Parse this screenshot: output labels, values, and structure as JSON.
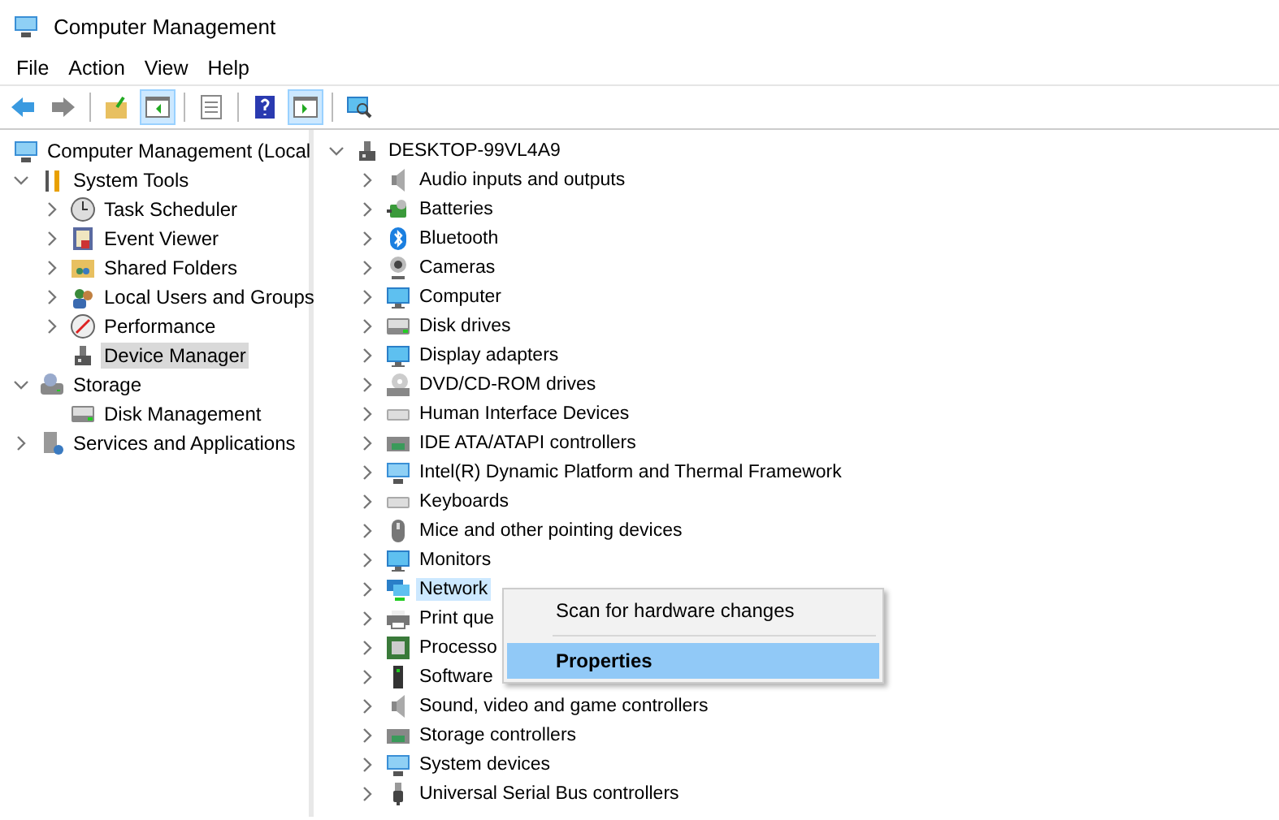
{
  "window": {
    "title": "Computer Management"
  },
  "menu_bar": [
    {
      "label": "File"
    },
    {
      "label": "Action"
    },
    {
      "label": "View"
    },
    {
      "label": "Help"
    }
  ],
  "toolbar": [
    {
      "pressed": false
    },
    {
      "pressed": false
    },
    {
      "pressed": false
    },
    {
      "pressed": true
    },
    {
      "pressed": false
    },
    {
      "pressed": false
    },
    {
      "pressed": true
    },
    {
      "pressed": false
    }
  ],
  "console_tree": {
    "label": "Computer Management (Local",
    "selected": false,
    "children": [
      {
        "label": "System Tools",
        "expanded": true,
        "selected": false,
        "children": [
          {
            "label": "Task Scheduler",
            "expanded": false,
            "selected": false
          },
          {
            "label": "Event Viewer",
            "expanded": false,
            "selected": false
          },
          {
            "label": "Shared Folders",
            "expanded": false,
            "selected": false
          },
          {
            "label": "Local Users and Groups",
            "expanded": false,
            "selected": false
          },
          {
            "label": "Performance",
            "expanded": false,
            "selected": false
          },
          {
            "label": "Device Manager",
            "selected": true
          }
        ]
      },
      {
        "label": "Storage",
        "expanded": true,
        "selected": false,
        "children": [
          {
            "label": "Disk Management",
            "selected": false
          }
        ]
      },
      {
        "label": "Services and Applications",
        "expanded": false,
        "selected": false
      }
    ]
  },
  "device_tree": {
    "label": "DESKTOP-99VL4A9",
    "expanded": true,
    "children": [
      {
        "label": "Audio inputs and outputs",
        "selected": false
      },
      {
        "label": "Batteries",
        "selected": false
      },
      {
        "label": "Bluetooth",
        "selected": false
      },
      {
        "label": "Cameras",
        "selected": false
      },
      {
        "label": "Computer",
        "selected": false
      },
      {
        "label": "Disk drives",
        "selected": false
      },
      {
        "label": "Display adapters",
        "selected": false
      },
      {
        "label": "DVD/CD-ROM drives",
        "selected": false
      },
      {
        "label": "Human Interface Devices",
        "selected": false
      },
      {
        "label": "IDE ATA/ATAPI controllers",
        "selected": false
      },
      {
        "label": "Intel(R) Dynamic Platform and Thermal Framework",
        "selected": false
      },
      {
        "label": "Keyboards",
        "selected": false
      },
      {
        "label": "Mice and other pointing devices",
        "selected": false
      },
      {
        "label": "Monitors",
        "selected": false
      },
      {
        "label": "Network",
        "selected": true
      },
      {
        "label": "Print que",
        "selected": false
      },
      {
        "label": "Processo",
        "selected": false
      },
      {
        "label": "Software",
        "selected": false
      },
      {
        "label": "Sound, video and game controllers",
        "selected": false
      },
      {
        "label": "Storage controllers",
        "selected": false
      },
      {
        "label": "System devices",
        "selected": false
      },
      {
        "label": "Universal Serial Bus controllers",
        "selected": false
      }
    ]
  },
  "context_menu": [
    {
      "kind": "item",
      "label": "Scan for hardware changes",
      "selected": false,
      "default": false
    },
    {
      "kind": "separator"
    },
    {
      "kind": "item",
      "label": "Properties",
      "selected": true,
      "default": true
    }
  ]
}
